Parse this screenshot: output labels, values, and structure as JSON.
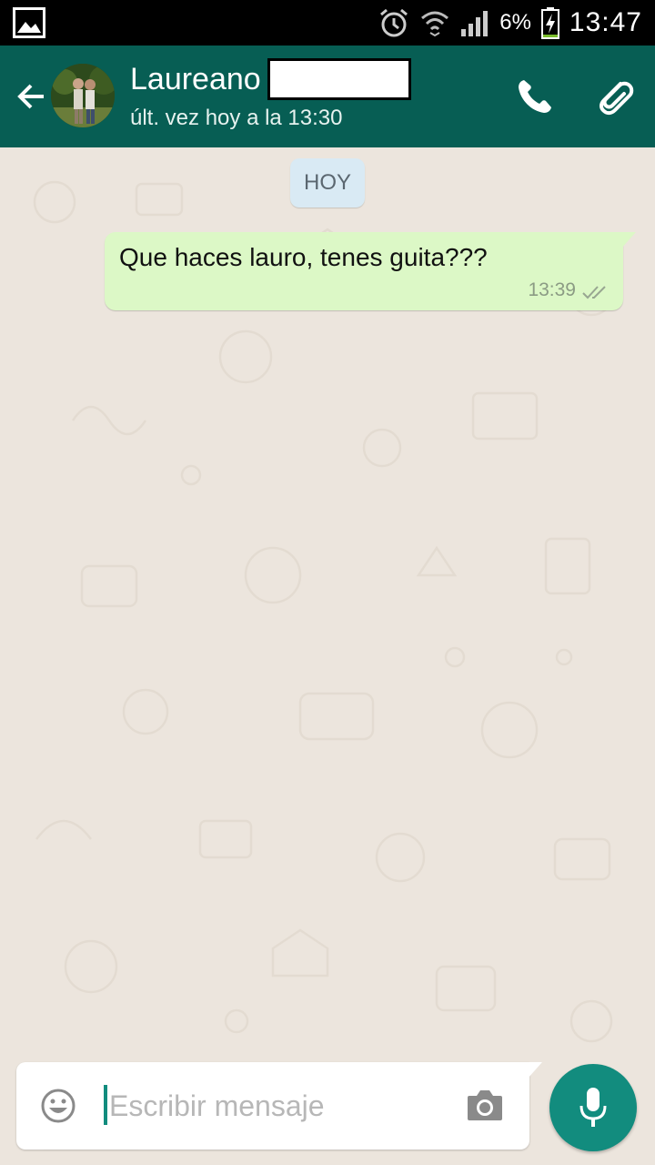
{
  "status_bar": {
    "battery_percent": "6%",
    "time": "13:47"
  },
  "header": {
    "contact_name": "Laureano",
    "last_seen": "últ. vez hoy a la 13:30",
    "accent_color": "#075e54"
  },
  "chat": {
    "date_label": "HOY",
    "messages": [
      {
        "text": "Que haces lauro, tenes guita???",
        "time": "13:39",
        "status": "delivered-double-check",
        "outgoing": true
      }
    ]
  },
  "composer": {
    "placeholder": "Escribir mensaje",
    "value": ""
  },
  "icons": {
    "status_left": "gallery-icon",
    "status_right": [
      "alarm-icon",
      "wifi-icon",
      "signal-icon",
      "battery-icon"
    ],
    "header_left": "back-arrow-icon",
    "header_right": [
      "phone-icon",
      "paperclip-icon"
    ],
    "composer": [
      "emoji-icon",
      "camera-icon",
      "microphone-icon"
    ]
  },
  "colors": {
    "chat_background": "#ece5dd",
    "outgoing_bubble": "#dcf8c6",
    "date_chip": "#d9eaf4",
    "mic_button": "#128c7e"
  }
}
